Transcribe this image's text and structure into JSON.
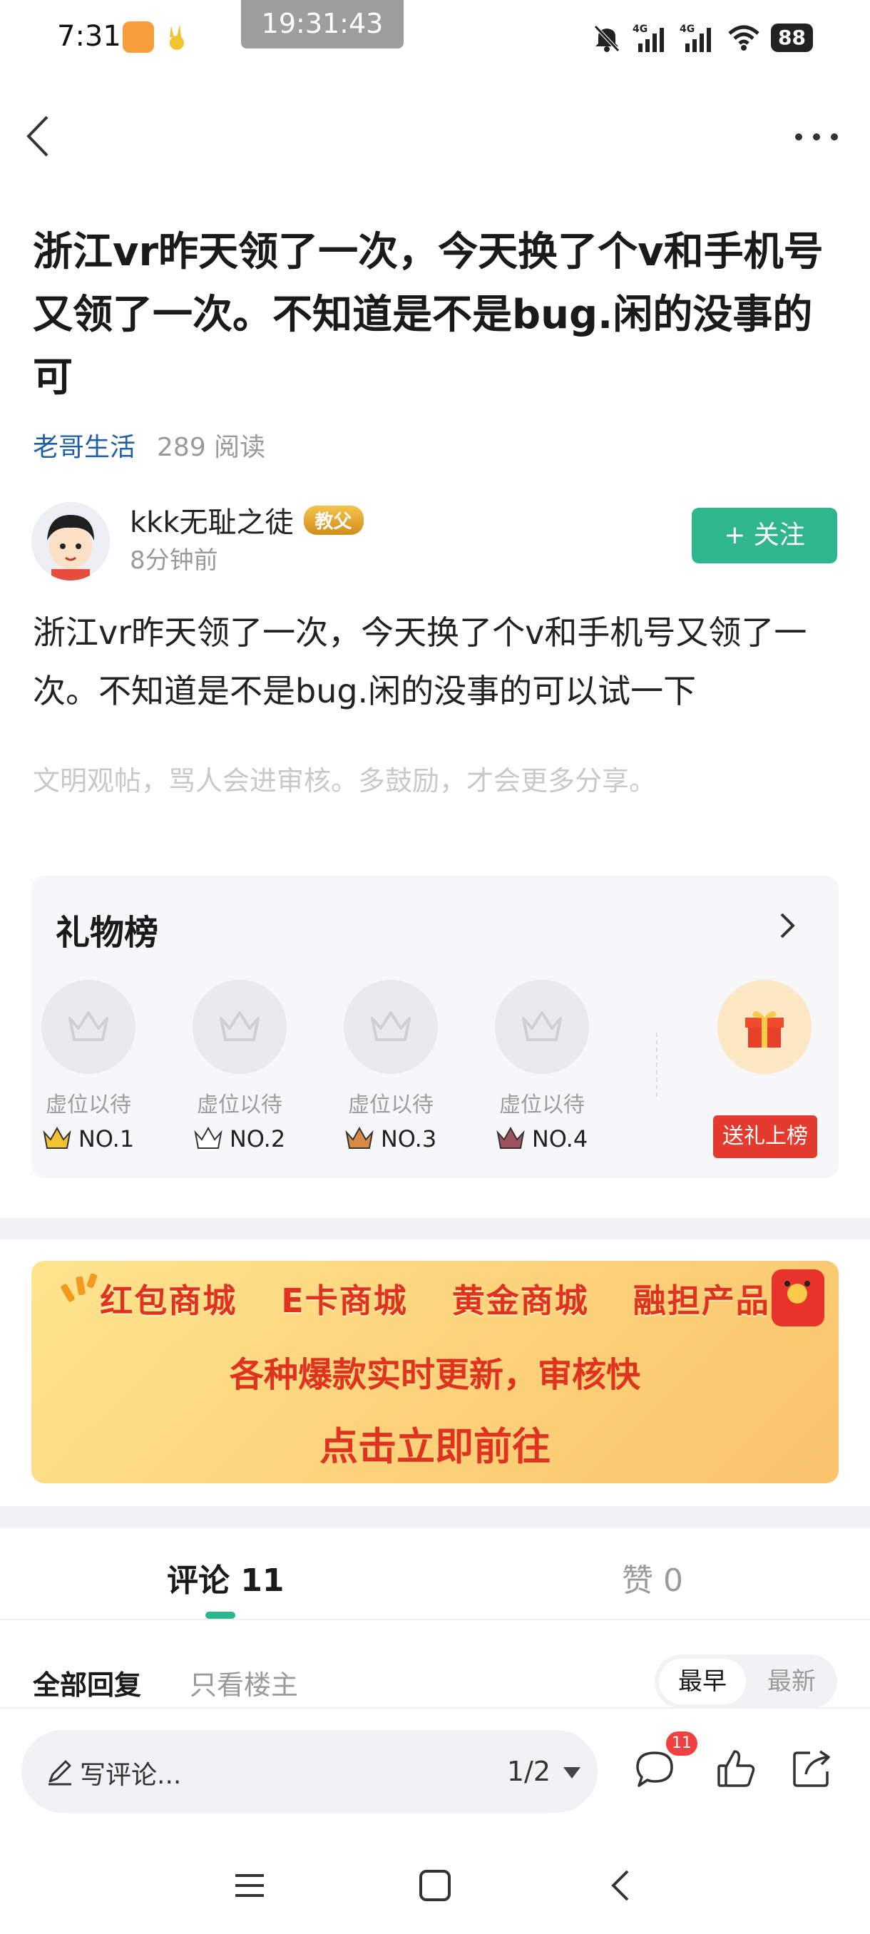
{
  "status_bar": {
    "time": "7:31",
    "clock": "19:31:43",
    "network_1": "4G",
    "network_2": "4G",
    "battery": "88"
  },
  "post": {
    "title": "浙江vr昨天领了一次，今天换了个v和手机号又领了一次。不知道是不是bug.闲的没事的可",
    "category": "老哥生活",
    "reads": "289 阅读",
    "author_name": "kkk无耻之徒",
    "author_badge": "教父",
    "time_ago": "8分钟前",
    "follow_label": "+ 关注",
    "content": "浙江vr昨天领了一次，今天换了个v和手机号又领了一次。不知道是不是bug.闲的没事的可以试一下",
    "notice": "文明观帖，骂人会进审核。多鼓励，才会更多分享。"
  },
  "gift_board": {
    "title": "礼物榜",
    "slots": [
      {
        "label": "虚位以待",
        "rank": "NO.1",
        "crown_color": "#f2c230"
      },
      {
        "label": "虚位以待",
        "rank": "NO.2",
        "crown_color": "#b9bcc6"
      },
      {
        "label": "虚位以待",
        "rank": "NO.3",
        "crown_color": "#d98a45"
      },
      {
        "label": "虚位以待",
        "rank": "NO.4",
        "crown_color": "#a0505e"
      }
    ],
    "send_label": "送礼上榜"
  },
  "banner": {
    "items": [
      "红包商城",
      "E卡商城",
      "黄金商城",
      "融担产品"
    ],
    "line2": "各种爆款实时更新，审核快",
    "line3": "点击立即前往"
  },
  "tabs": {
    "comments": "评论 11",
    "likes": "赞 0"
  },
  "filters": {
    "all": "全部回复",
    "op_only": "只看楼主",
    "oldest": "最早",
    "newest": "最新"
  },
  "bottom_bar": {
    "placeholder": "写评论...",
    "page": "1/2",
    "comment_count": "11"
  },
  "colors": {
    "accent": "#2fb68f",
    "link": "#1f5fa6",
    "red": "#e33c2e"
  }
}
